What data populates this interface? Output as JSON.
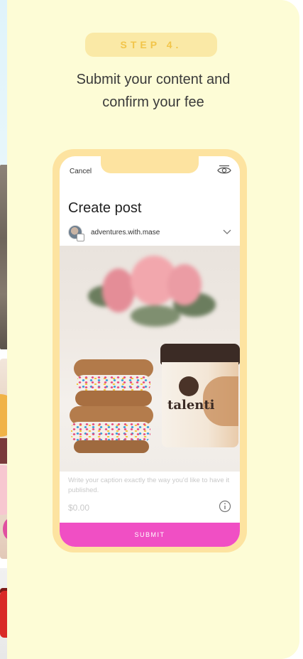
{
  "step": {
    "label": "STEP 4."
  },
  "headline": {
    "line1": "Submit your content and",
    "line2": "confirm your fee"
  },
  "phone": {
    "cancel_label": "Cancel",
    "title": "Create post",
    "account_name": "adventures.with.mase",
    "caption_placeholder": "Write your caption exactly the way you'd like to have it published.",
    "price": "$0.00",
    "submit_label": "SUBMIT",
    "photo_brand_text": "talenti"
  },
  "colors": {
    "card_bg": "#fdfcd6",
    "step_pill_bg": "#fae9a6",
    "step_text": "#f2c54a",
    "phone_frame": "#fde3a0",
    "submit_bg": "#f04fc4"
  },
  "icons": [
    "eye-icon",
    "chevron-down-icon",
    "info-icon",
    "avatar"
  ]
}
